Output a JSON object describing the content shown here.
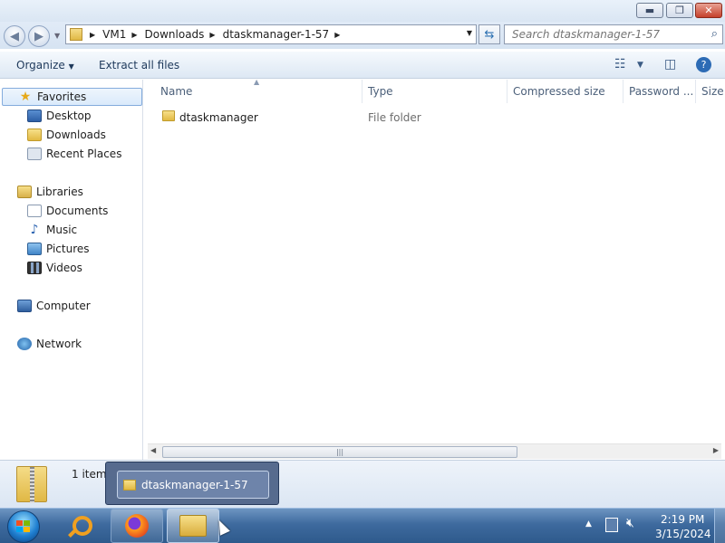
{
  "window": {
    "controls": {
      "minimize": "▬",
      "maximize": "❐",
      "close": "✕"
    }
  },
  "address": {
    "segments": [
      "VM1",
      "Downloads",
      "dtaskmanager-1-57"
    ],
    "search_placeholder": "Search dtaskmanager-1-57"
  },
  "toolbar": {
    "organize_label": "Organize",
    "extract_label": "Extract all files"
  },
  "nav": {
    "favorites_label": "Favorites",
    "favorites": [
      "Desktop",
      "Downloads",
      "Recent Places"
    ],
    "libraries_label": "Libraries",
    "libraries": [
      "Documents",
      "Music",
      "Pictures",
      "Videos"
    ],
    "computer_label": "Computer",
    "network_label": "Network"
  },
  "columns": [
    "Name",
    "Type",
    "Compressed size",
    "Password ...",
    "Size"
  ],
  "files": [
    {
      "name": "dtaskmanager",
      "type": "File folder",
      "icon": "folder-icon"
    }
  ],
  "details": {
    "item_count": "1 item"
  },
  "preview": {
    "title": "dtaskmanager-1-57"
  },
  "clock": {
    "time": "2:19 PM",
    "date": "3/15/2024"
  },
  "colors": {
    "taskbar": "#3e6a9e",
    "selection_border": "#84acdd",
    "link_text": "#1e395b"
  }
}
